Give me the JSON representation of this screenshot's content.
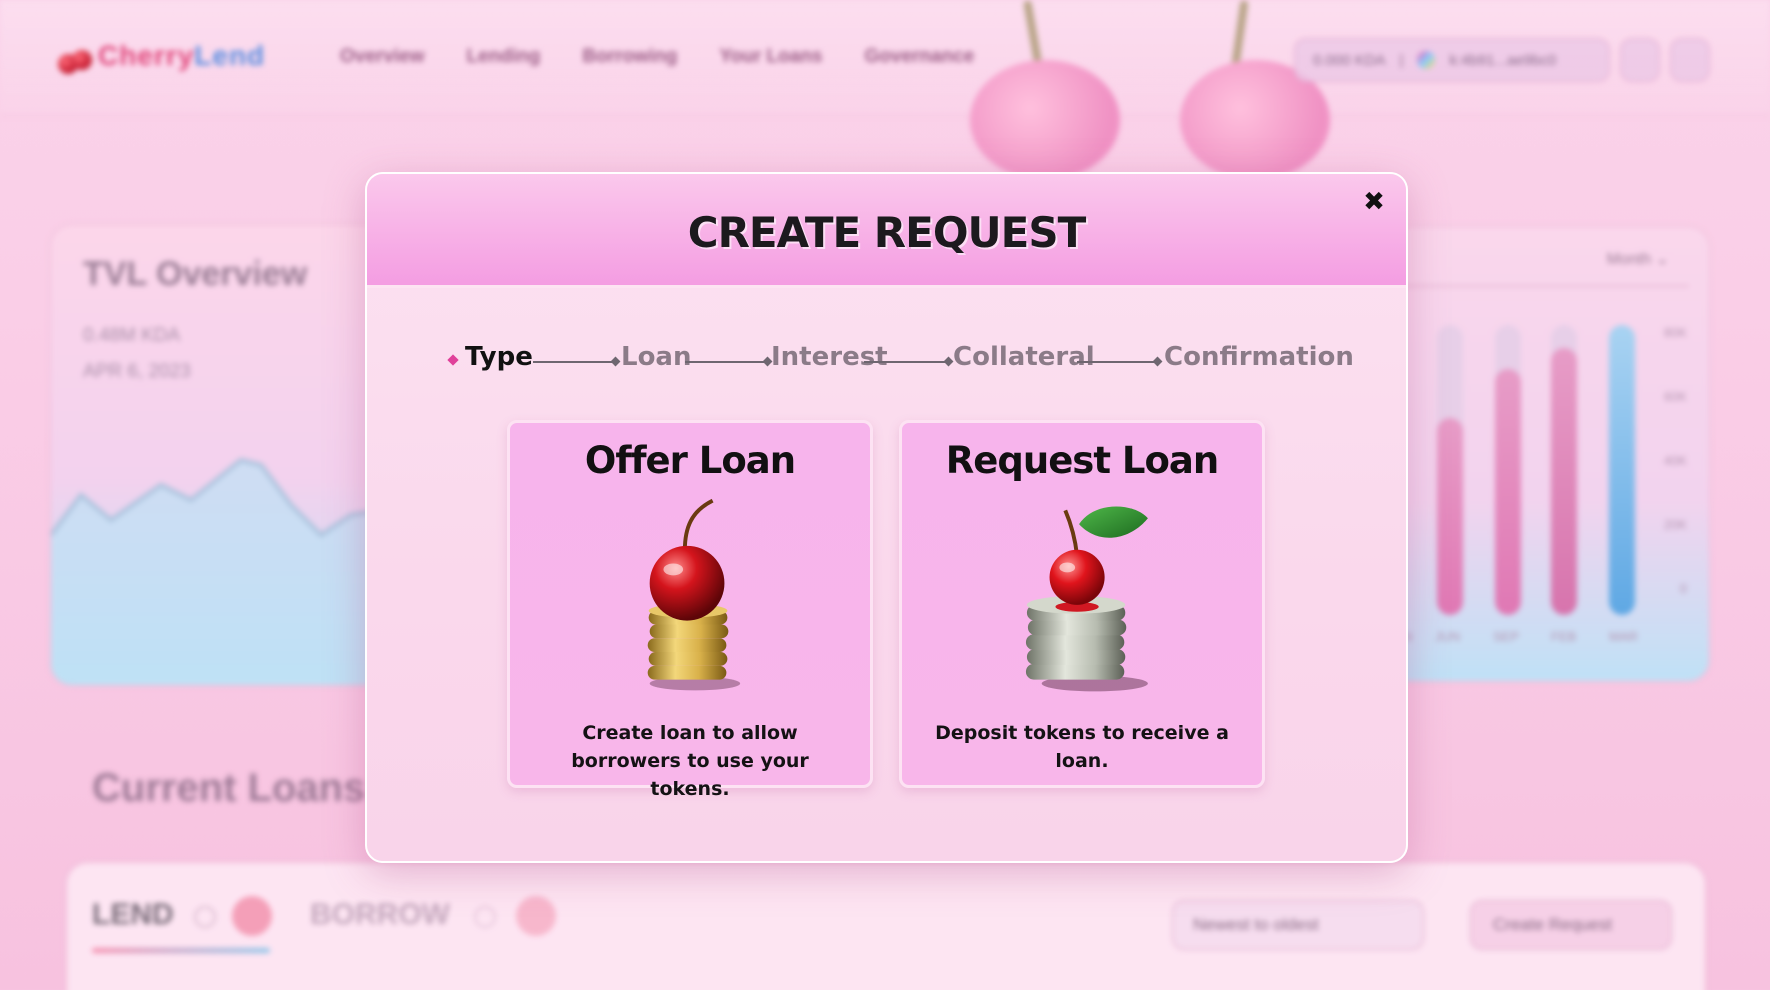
{
  "app": {
    "logo": {
      "part1": "Cherry",
      "part2": "Lend"
    },
    "nav": [
      "Overview",
      "Lending",
      "Borrowing",
      "Your Loans",
      "Governance"
    ],
    "wallet": {
      "balance": "0.000 KDA",
      "address": "k:4b91...ae9bc0"
    }
  },
  "background": {
    "tvl": {
      "title": "TVL Overview",
      "amount": "0.48M KDA",
      "date": "APR 6, 2023"
    },
    "bars": {
      "period": "Month ⌄",
      "y_ticks": [
        "80K",
        "60K",
        "40K",
        "20K",
        "0"
      ],
      "x_ticks": [
        "JUN",
        "JUN",
        "SEP",
        "FEB",
        "MAR"
      ],
      "fills": [
        0.68,
        0.85,
        0.92,
        1.0
      ]
    },
    "current_loans": {
      "title": "Current Loans",
      "tab_lend": "LEND",
      "tab_borrow": "BORROW",
      "sort_value": "Newest to oldest",
      "create_button": "Create Request"
    }
  },
  "modal": {
    "title": "CREATE REQUEST",
    "close_label": "✖",
    "steps": [
      {
        "label": "Type",
        "active": true
      },
      {
        "label": "Loan",
        "active": false
      },
      {
        "label": "Interest",
        "active": false
      },
      {
        "label": "Collateral",
        "active": false
      },
      {
        "label": "Confirmation",
        "active": false
      }
    ],
    "options": [
      {
        "title": "Offer Loan",
        "description": "Create loan to allow borrowers to use your tokens.",
        "icon": "cherry-on-gold-coins-icon"
      },
      {
        "title": "Request Loan",
        "description": "Deposit tokens to receive a loan.",
        "icon": "cherry-on-silver-coins-icon"
      }
    ]
  },
  "colors": {
    "modal_header": "#f49de2",
    "card_bg": "#f7b4ec",
    "active_step_marker": "#e0409a"
  }
}
